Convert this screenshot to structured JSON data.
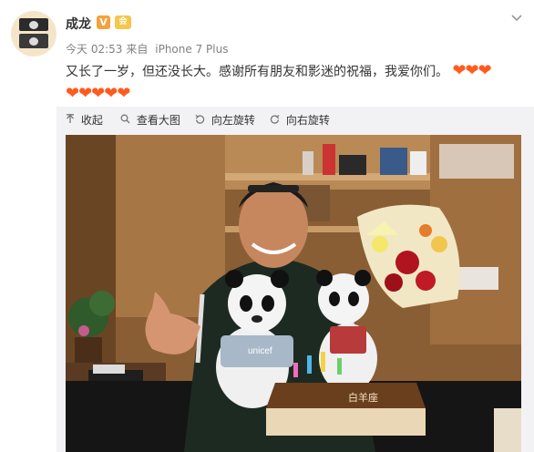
{
  "post": {
    "author": "成龙",
    "verified_badge": "V",
    "vip_badge": "会",
    "time": "今天 02:53",
    "source_prefix": "来自",
    "source": "iPhone 7 Plus",
    "text": "又长了一岁，但还没长大。感谢所有朋友和影迷的祝福，我爱你们。",
    "hearts_line1": "❤❤❤",
    "hearts_line2": "❤❤❤❤❤"
  },
  "toolbar": {
    "collapse": "收起",
    "view_large": "查看大图",
    "rotate_left": "向左旋转",
    "rotate_right": "向右旋转"
  },
  "photo": {
    "cake_text": "白羊座",
    "bag_text": "unicef"
  },
  "colors": {
    "heart": "#ff5b1e",
    "toolbar_bg": "#f2f2f5",
    "meta": "#808080"
  }
}
